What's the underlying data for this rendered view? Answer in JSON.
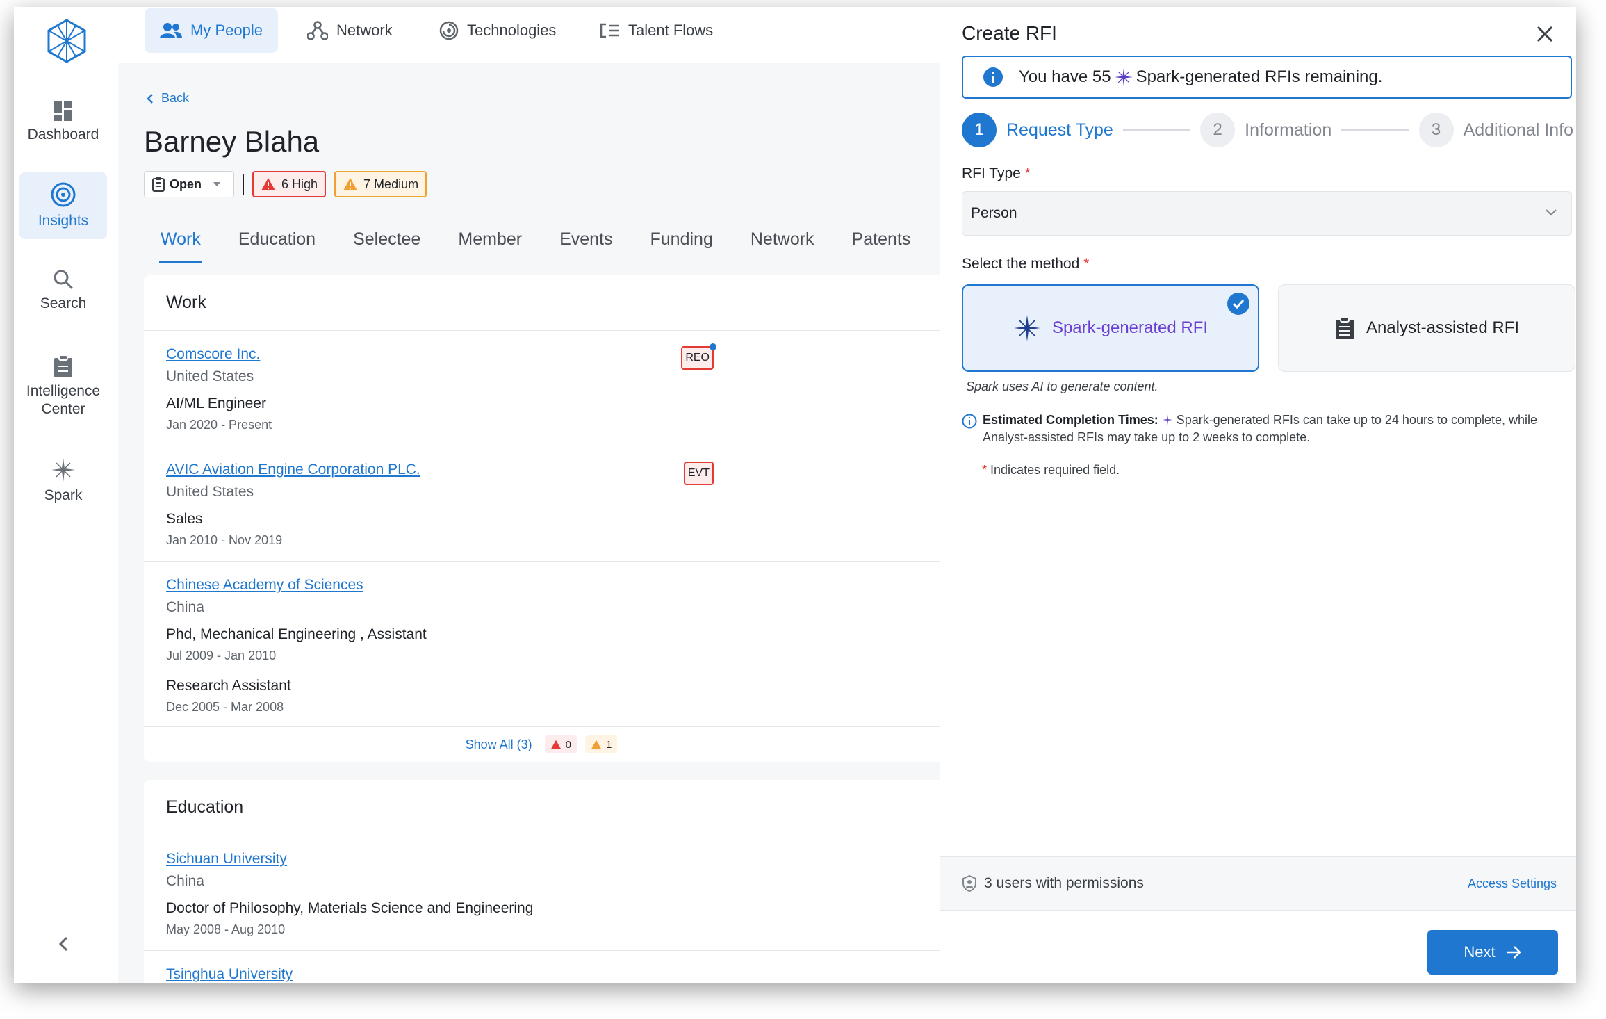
{
  "rail": {
    "items": [
      {
        "label": "Dashboard",
        "icon": "dashboard-icon"
      },
      {
        "label": "Insights",
        "icon": "target-icon"
      },
      {
        "label": "Search",
        "icon": "search-icon"
      },
      {
        "label": "Intelligence Center",
        "icon": "clipboard-icon"
      },
      {
        "label": "Spark",
        "icon": "spark-icon"
      }
    ]
  },
  "topnav": {
    "tabs": [
      {
        "label": "My People",
        "icon": "people-icon"
      },
      {
        "label": "Network",
        "icon": "network-icon"
      },
      {
        "label": "Technologies",
        "icon": "technologies-icon"
      },
      {
        "label": "Talent Flows",
        "icon": "talent-flows-icon"
      }
    ]
  },
  "profile": {
    "back_label": "Back",
    "name": "Barney Blaha",
    "status": "Open",
    "high_label": "6 High",
    "medium_label": "7 Medium",
    "tabs": [
      "Work",
      "Education",
      "Selectee",
      "Member",
      "Events",
      "Funding",
      "Network",
      "Patents"
    ]
  },
  "work": {
    "title": "Work",
    "entries": [
      {
        "org": "Comscore Inc.",
        "country": "United States",
        "role": "AI/ML Engineer",
        "dates": "Jan 2020 - Present",
        "tag": "REO"
      },
      {
        "org": "AVIC Aviation Engine Corporation PLC.",
        "country": "United States",
        "role": "Sales",
        "dates": "Jan 2010 - Nov 2019",
        "tag": "EVT"
      },
      {
        "org": "Chinese Academy of Sciences",
        "country": "China",
        "role": "Phd, Mechanical Engineering , Assistant",
        "dates": "Jul 2009 - Jan 2010",
        "role2": "Research Assistant",
        "dates2": "Dec 2005 - Mar 2008"
      }
    ],
    "show_all": "Show All (3)",
    "high_count": "0",
    "medium_count": "1"
  },
  "education": {
    "title": "Education",
    "entries": [
      {
        "org": "Sichuan University",
        "country": "China",
        "role": "Doctor of Philosophy, Materials Science and Engineering",
        "dates": "May 2008 - Aug 2010"
      },
      {
        "org": "Tsinghua University"
      }
    ]
  },
  "drawer": {
    "title": "Create RFI",
    "banner_prefix": "You have 55",
    "banner_suffix": "Spark-generated RFIs remaining.",
    "steps": [
      {
        "num": "1",
        "label": "Request Type"
      },
      {
        "num": "2",
        "label": "Information"
      },
      {
        "num": "3",
        "label": "Additional Info"
      }
    ],
    "rfi_type_label": "RFI Type",
    "rfi_type_value": "Person",
    "method_label": "Select the method",
    "method_spark": "Spark-generated RFI",
    "method_analyst": "Analyst-assisted RFI",
    "method_help": "Spark uses AI to generate content.",
    "est_title": "Estimated Completion Times:",
    "est_text": "Spark-generated RFIs can take up to 24 hours to complete, while Analyst-assisted RFIs may take up to 2 weeks to complete.",
    "required_note": "Indicates required field.",
    "required_mark": "*",
    "permissions": "3 users with permissions",
    "access_settings": "Access Settings",
    "next": "Next"
  },
  "colors": {
    "accent": "#1f77d0",
    "high": "#e53935",
    "medium": "#f0a030",
    "spark": "#6b3fd0"
  }
}
